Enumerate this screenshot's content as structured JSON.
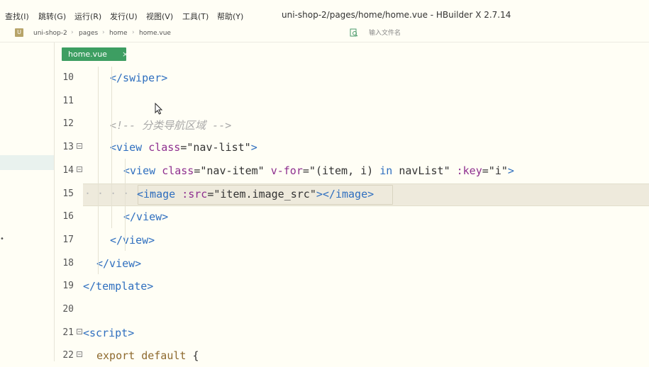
{
  "menu": {
    "items": [
      "查找(I)",
      "跳转(G)",
      "运行(R)",
      "发行(U)",
      "视图(V)",
      "工具(T)",
      "帮助(Y)"
    ],
    "window_title": "uni-shop-2/pages/home/home.vue - HBuilder X 2.7.14"
  },
  "breadcrumb": {
    "project_icon_letter": "U",
    "items": [
      "uni-shop-2",
      "pages",
      "home",
      "home.vue"
    ],
    "file_search_placeholder": "输入文件名"
  },
  "tabs": [
    {
      "label": "home.vue",
      "close": "×",
      "active": true
    }
  ],
  "editor": {
    "lines": [
      {
        "num": "10",
        "fold": false,
        "tokens": [
          [
            "tag",
            "</swiper>"
          ]
        ]
      },
      {
        "num": "11",
        "fold": false,
        "tokens": []
      },
      {
        "num": "12",
        "fold": false,
        "tokens": [
          [
            "cmt",
            "<!-- 分类导航区域 -->"
          ]
        ]
      },
      {
        "num": "13",
        "fold": true,
        "tokens": [
          [
            "tag",
            "<view "
          ],
          [
            "attr",
            "class"
          ],
          [
            "punct",
            "=\""
          ],
          [
            "str",
            "nav-list"
          ],
          [
            "punct",
            "\""
          ],
          [
            "tag",
            ">"
          ]
        ]
      },
      {
        "num": "14",
        "fold": true,
        "tokens": [
          [
            "tag",
            "<view "
          ],
          [
            "attr",
            "class"
          ],
          [
            "punct",
            "=\""
          ],
          [
            "str",
            "nav-item"
          ],
          [
            "punct",
            "\" "
          ],
          [
            "attr",
            "v-for"
          ],
          [
            "punct",
            "=\""
          ],
          [
            "plain",
            "(item, i) "
          ],
          [
            "kw",
            "in"
          ],
          [
            "plain",
            " navList"
          ],
          [
            "punct",
            "\" "
          ],
          [
            "attr",
            ":key"
          ],
          [
            "punct",
            "=\""
          ],
          [
            "str",
            "i"
          ],
          [
            "punct",
            "\""
          ],
          [
            "tag",
            ">"
          ]
        ]
      },
      {
        "num": "15",
        "fold": false,
        "tokens": [
          [
            "tag",
            "<image "
          ],
          [
            "attr",
            ":src"
          ],
          [
            "punct",
            "=\""
          ],
          [
            "plain",
            "item.image_src"
          ],
          [
            "punct",
            "\""
          ],
          [
            "tag",
            "></image>"
          ]
        ]
      },
      {
        "num": "16",
        "fold": false,
        "tokens": [
          [
            "tag",
            "</view>"
          ]
        ]
      },
      {
        "num": "17",
        "fold": false,
        "tokens": [
          [
            "tag",
            "</view>"
          ]
        ]
      },
      {
        "num": "18",
        "fold": false,
        "tokens": [
          [
            "tag",
            "</view>"
          ]
        ]
      },
      {
        "num": "19",
        "fold": false,
        "tokens": [
          [
            "tag",
            "</template>"
          ]
        ]
      },
      {
        "num": "20",
        "fold": false,
        "tokens": []
      },
      {
        "num": "21",
        "fold": true,
        "tokens": [
          [
            "tag",
            "<script>"
          ]
        ]
      },
      {
        "num": "22",
        "fold": true,
        "tokens": [
          [
            "jskw",
            "export default "
          ],
          [
            "plain",
            "{"
          ]
        ]
      }
    ]
  },
  "colors": {
    "tab_active": "#3d9e62",
    "tag": "#2f6fbf",
    "attribute": "#8e2f8f",
    "comment": "#a8a8a8",
    "background": "#fffef5"
  }
}
